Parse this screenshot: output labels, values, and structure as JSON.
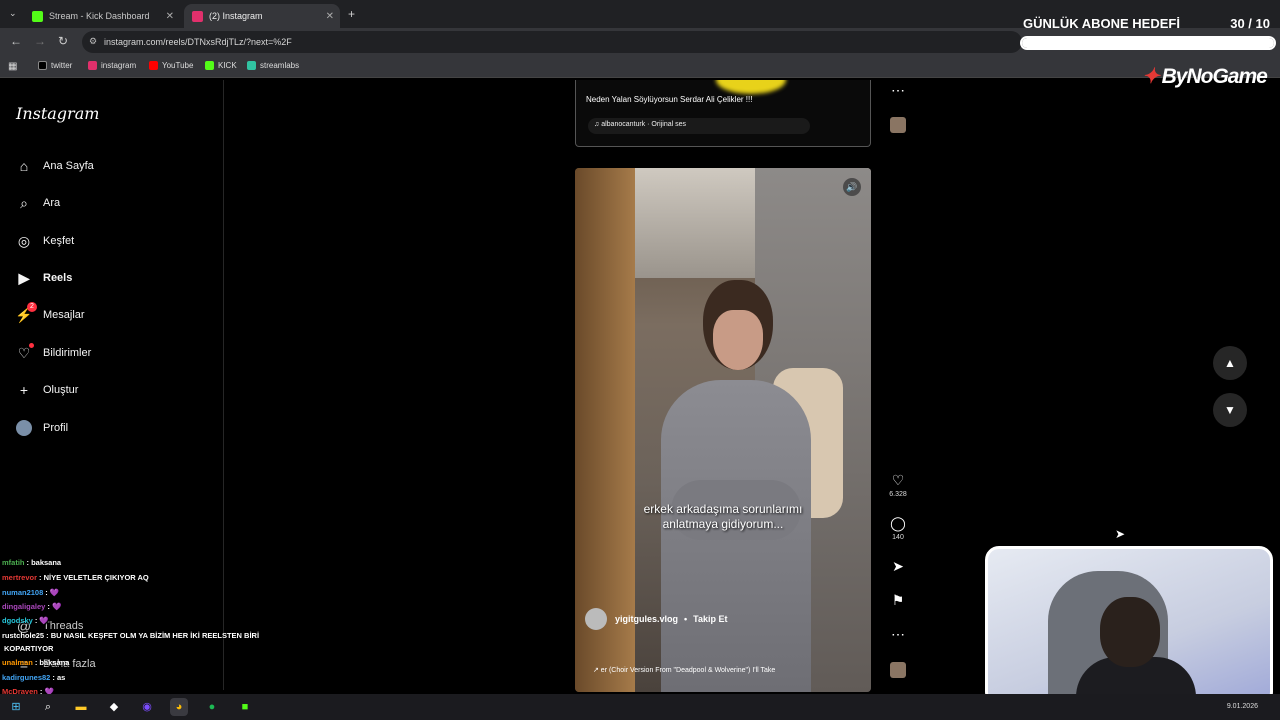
{
  "browser": {
    "tabs": [
      {
        "label": "Stream - Kick Dashboard",
        "color": "#53fc18"
      },
      {
        "label": "(2) Instagram",
        "color": "#e1306c"
      }
    ],
    "url": "instagram.com/reels/DTNxsRdjTLz/?next=%2F",
    "bookmarks": [
      "twitter",
      "instagram",
      "YouTube",
      "KICK",
      "streamlabs"
    ]
  },
  "stream_overlay": {
    "goal_title": "GÜNLÜK ABONE HEDEFİ",
    "goal_count": "30  / 10",
    "goal_progress": 1.0,
    "brand": "ByNoGame"
  },
  "instagram": {
    "logo": "Instagram",
    "nav": [
      {
        "label": "Ana Sayfa",
        "icon": "home-icon"
      },
      {
        "label": "Ara",
        "icon": "search-icon"
      },
      {
        "label": "Keşfet",
        "icon": "compass-icon"
      },
      {
        "label": "Reels",
        "icon": "reels-icon"
      },
      {
        "label": "Mesajlar",
        "icon": "messenger-icon",
        "badge": "2"
      },
      {
        "label": "Bildirimler",
        "icon": "heart-icon"
      },
      {
        "label": "Oluştur",
        "icon": "plus-icon"
      },
      {
        "label": "Profil",
        "icon": "avatar-icon"
      }
    ],
    "threads_label": "Threads",
    "more_label": "Daha fazla",
    "reel_prev": {
      "caption": "Neden Yalan Söylüyorsun Serdar Ali Çelikler !!!",
      "audio": "albanocanturk · Orijinal ses"
    },
    "reel": {
      "subtitle_line1": "erkek arkadaşıma sorunlarımı",
      "subtitle_line2": "anlatmaya gidiyorum...",
      "author": "yigitgules.vlog",
      "separator": "•",
      "follow": "Takip Et",
      "music": "↗ er (Choir Version From \"Deadpool & Wolverine\")  I'll Take"
    },
    "actions": {
      "likes": "6.328",
      "comments": "140"
    }
  },
  "chat": [
    {
      "user": "mfatih",
      "msg": ": baksana",
      "color": "#4caf50"
    },
    {
      "user": "mertrevor",
      "msg": ": NİYE VELETLER ÇIKIYOR AQ",
      "color": "#e53935"
    },
    {
      "user": "numan2108",
      "msg": ": 💜",
      "color": "#42a5f5"
    },
    {
      "user": "dingaligaley",
      "msg": ": 💜",
      "color": "#ab47bc"
    },
    {
      "user": "dgodsky",
      "msg": ": 💜",
      "color": "#26c6da"
    },
    {
      "user": "rustchole25",
      "msg": ": BU NASIL KEŞFET OLM YA BİZİM HER İKİ REELSTEN BİRİ",
      "color": "#ffffff"
    },
    {
      "user": "",
      "msg": "KOPARTIYOR",
      "color": "#ffffff"
    },
    {
      "user": "unalman",
      "msg": ": baksana",
      "color": "#ff9800"
    },
    {
      "user": "kadirgunes82",
      "msg": ": as",
      "color": "#42a5f5"
    },
    {
      "user": "McDraven",
      "msg": ": 💜",
      "color": "#e53935"
    }
  ],
  "taskbar": {
    "date": "9.01.2026"
  }
}
